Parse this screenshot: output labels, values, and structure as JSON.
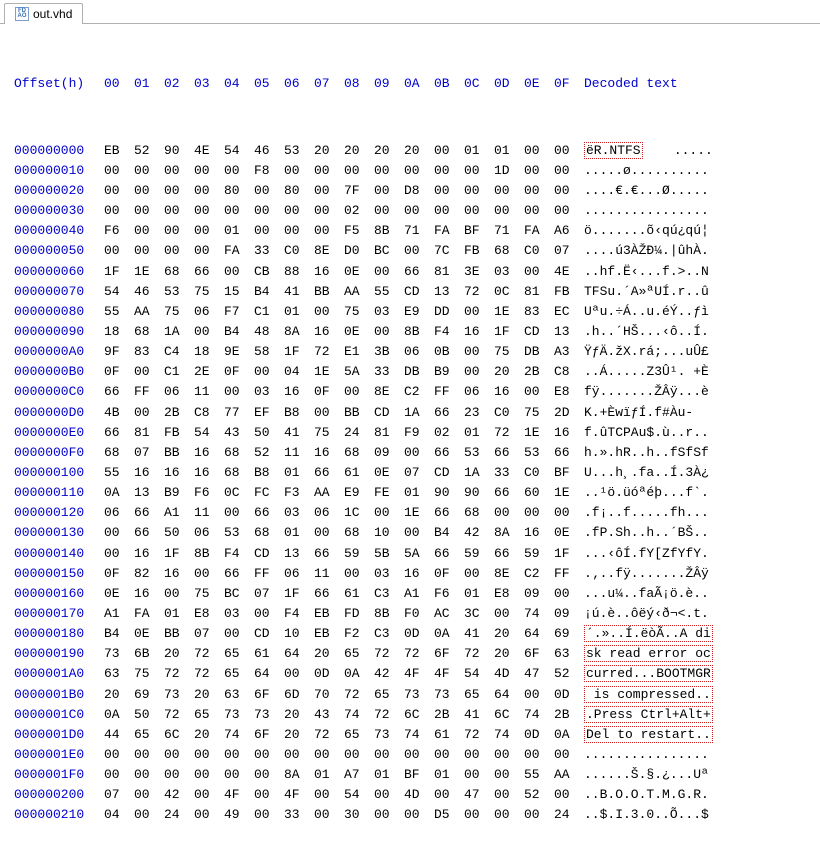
{
  "tab": {
    "filename": "out.vhd",
    "icon_label": "FD\nAO"
  },
  "header": {
    "offset_label": "Offset(h)",
    "byte_cols": [
      "00",
      "01",
      "02",
      "03",
      "04",
      "05",
      "06",
      "07",
      "08",
      "09",
      "0A",
      "0B",
      "0C",
      "0D",
      "0E",
      "0F"
    ],
    "decoded_label": "Decoded text"
  },
  "highlight_row0_decoded_prefix": "ëR.NTFS",
  "highlight_row0_decoded_suffix": "    .....",
  "rows": [
    {
      "o": "000000000",
      "b": [
        "EB",
        "52",
        "90",
        "4E",
        "54",
        "46",
        "53",
        "20",
        "20",
        "20",
        "20",
        "00",
        "01",
        "01",
        "00",
        "00"
      ],
      "d": "ëR.NTFS    ....."
    },
    {
      "o": "000000010",
      "b": [
        "00",
        "00",
        "00",
        "00",
        "00",
        "F8",
        "00",
        "00",
        "00",
        "00",
        "00",
        "00",
        "00",
        "1D",
        "00",
        "00"
      ],
      "d": ".....ø.........."
    },
    {
      "o": "000000020",
      "b": [
        "00",
        "00",
        "00",
        "00",
        "80",
        "00",
        "80",
        "00",
        "7F",
        "00",
        "D8",
        "00",
        "00",
        "00",
        "00",
        "00"
      ],
      "d": "....€.€...Ø....."
    },
    {
      "o": "000000030",
      "b": [
        "00",
        "00",
        "00",
        "00",
        "00",
        "00",
        "00",
        "00",
        "02",
        "00",
        "00",
        "00",
        "00",
        "00",
        "00",
        "00"
      ],
      "d": "................"
    },
    {
      "o": "000000040",
      "b": [
        "F6",
        "00",
        "00",
        "00",
        "01",
        "00",
        "00",
        "00",
        "F5",
        "8B",
        "71",
        "FA",
        "BF",
        "71",
        "FA",
        "A6"
      ],
      "d": "ö.......õ‹qú¿qú¦"
    },
    {
      "o": "000000050",
      "b": [
        "00",
        "00",
        "00",
        "00",
        "FA",
        "33",
        "C0",
        "8E",
        "D0",
        "BC",
        "00",
        "7C",
        "FB",
        "68",
        "C0",
        "07"
      ],
      "d": "....ú3ÀŽÐ¼.|ûhÀ."
    },
    {
      "o": "000000060",
      "b": [
        "1F",
        "1E",
        "68",
        "66",
        "00",
        "CB",
        "88",
        "16",
        "0E",
        "00",
        "66",
        "81",
        "3E",
        "03",
        "00",
        "4E"
      ],
      "d": "..hf.Ë‹...f.>..N"
    },
    {
      "o": "000000070",
      "b": [
        "54",
        "46",
        "53",
        "75",
        "15",
        "B4",
        "41",
        "BB",
        "AA",
        "55",
        "CD",
        "13",
        "72",
        "0C",
        "81",
        "FB"
      ],
      "d": "TFSu.´A»ªUÍ.r..û"
    },
    {
      "o": "000000080",
      "b": [
        "55",
        "AA",
        "75",
        "06",
        "F7",
        "C1",
        "01",
        "00",
        "75",
        "03",
        "E9",
        "DD",
        "00",
        "1E",
        "83",
        "EC"
      ],
      "d": "Uªu.÷Á..u.éÝ..ƒì"
    },
    {
      "o": "000000090",
      "b": [
        "18",
        "68",
        "1A",
        "00",
        "B4",
        "48",
        "8A",
        "16",
        "0E",
        "00",
        "8B",
        "F4",
        "16",
        "1F",
        "CD",
        "13"
      ],
      "d": ".h..´HŠ...‹ô..Í."
    },
    {
      "o": "0000000A0",
      "b": [
        "9F",
        "83",
        "C4",
        "18",
        "9E",
        "58",
        "1F",
        "72",
        "E1",
        "3B",
        "06",
        "0B",
        "00",
        "75",
        "DB",
        "A3"
      ],
      "d": "ŸƒÄ.žX.rá;...uÛ£"
    },
    {
      "o": "0000000B0",
      "b": [
        "0F",
        "00",
        "C1",
        "2E",
        "0F",
        "00",
        "04",
        "1E",
        "5A",
        "33",
        "DB",
        "B9",
        "00",
        "20",
        "2B",
        "C8"
      ],
      "d": "..Á.....Z3Û¹. +È"
    },
    {
      "o": "0000000C0",
      "b": [
        "66",
        "FF",
        "06",
        "11",
        "00",
        "03",
        "16",
        "0F",
        "00",
        "8E",
        "C2",
        "FF",
        "06",
        "16",
        "00",
        "E8"
      ],
      "d": "fÿ.......ŽÂÿ...è"
    },
    {
      "o": "0000000D0",
      "b": [
        "4B",
        "00",
        "2B",
        "C8",
        "77",
        "EF",
        "B8",
        "00",
        "BB",
        "CD",
        "1A",
        "66",
        "23",
        "C0",
        "75",
        "2D"
      ],
      "d": "K.+ÈwïƒÍ.f#Àu-"
    },
    {
      "o": "0000000E0",
      "b": [
        "66",
        "81",
        "FB",
        "54",
        "43",
        "50",
        "41",
        "75",
        "24",
        "81",
        "F9",
        "02",
        "01",
        "72",
        "1E",
        "16"
      ],
      "d": "f.ûTCPAu$.ù..r.."
    },
    {
      "o": "0000000F0",
      "b": [
        "68",
        "07",
        "BB",
        "16",
        "68",
        "52",
        "11",
        "16",
        "68",
        "09",
        "00",
        "66",
        "53",
        "66",
        "53",
        "66"
      ],
      "d": "h.».hR..h..fSfSf"
    },
    {
      "o": "000000100",
      "b": [
        "55",
        "16",
        "16",
        "16",
        "68",
        "B8",
        "01",
        "66",
        "61",
        "0E",
        "07",
        "CD",
        "1A",
        "33",
        "C0",
        "BF"
      ],
      "d": "U...h¸.fa..Í.3À¿"
    },
    {
      "o": "000000110",
      "b": [
        "0A",
        "13",
        "B9",
        "F6",
        "0C",
        "FC",
        "F3",
        "AA",
        "E9",
        "FE",
        "01",
        "90",
        "90",
        "66",
        "60",
        "1E"
      ],
      "d": "..¹ö.üóªéþ...f`."
    },
    {
      "o": "000000120",
      "b": [
        "06",
        "66",
        "A1",
        "11",
        "00",
        "66",
        "03",
        "06",
        "1C",
        "00",
        "1E",
        "66",
        "68",
        "00",
        "00",
        "00"
      ],
      "d": ".f¡..f.....fh..."
    },
    {
      "o": "000000130",
      "b": [
        "00",
        "66",
        "50",
        "06",
        "53",
        "68",
        "01",
        "00",
        "68",
        "10",
        "00",
        "B4",
        "42",
        "8A",
        "16",
        "0E"
      ],
      "d": ".fP.Sh..h..´BŠ.."
    },
    {
      "o": "000000140",
      "b": [
        "00",
        "16",
        "1F",
        "8B",
        "F4",
        "CD",
        "13",
        "66",
        "59",
        "5B",
        "5A",
        "66",
        "59",
        "66",
        "59",
        "1F"
      ],
      "d": "...‹ôÍ.fY[ZfYfY."
    },
    {
      "o": "000000150",
      "b": [
        "0F",
        "82",
        "16",
        "00",
        "66",
        "FF",
        "06",
        "11",
        "00",
        "03",
        "16",
        "0F",
        "00",
        "8E",
        "C2",
        "FF"
      ],
      "d": ".‚..fÿ.......ŽÂÿ"
    },
    {
      "o": "000000160",
      "b": [
        "0E",
        "16",
        "00",
        "75",
        "BC",
        "07",
        "1F",
        "66",
        "61",
        "C3",
        "A1",
        "F6",
        "01",
        "E8",
        "09",
        "00"
      ],
      "d": "...u¼..faÃ¡ö.è.."
    },
    {
      "o": "000000170",
      "b": [
        "A1",
        "FA",
        "01",
        "E8",
        "03",
        "00",
        "F4",
        "EB",
        "FD",
        "8B",
        "F0",
        "AC",
        "3C",
        "00",
        "74",
        "09"
      ],
      "d": "¡ú.è..ôëý‹ð¬<.t."
    },
    {
      "o": "000000180",
      "b": [
        "B4",
        "0E",
        "BB",
        "07",
        "00",
        "CD",
        "10",
        "EB",
        "F2",
        "C3",
        "0D",
        "0A",
        "41",
        "20",
        "64",
        "69"
      ],
      "d": "´.»..Í.ëòÃ..A di"
    },
    {
      "o": "000000190",
      "b": [
        "73",
        "6B",
        "20",
        "72",
        "65",
        "61",
        "64",
        "20",
        "65",
        "72",
        "72",
        "6F",
        "72",
        "20",
        "6F",
        "63"
      ],
      "d": "sk read error oc"
    },
    {
      "o": "0000001A0",
      "b": [
        "63",
        "75",
        "72",
        "72",
        "65",
        "64",
        "00",
        "0D",
        "0A",
        "42",
        "4F",
        "4F",
        "54",
        "4D",
        "47",
        "52"
      ],
      "d": "curred...BOOTMGR"
    },
    {
      "o": "0000001B0",
      "b": [
        "20",
        "69",
        "73",
        "20",
        "63",
        "6F",
        "6D",
        "70",
        "72",
        "65",
        "73",
        "73",
        "65",
        "64",
        "00",
        "0D"
      ],
      "d": " is compressed.."
    },
    {
      "o": "0000001C0",
      "b": [
        "0A",
        "50",
        "72",
        "65",
        "73",
        "73",
        "20",
        "43",
        "74",
        "72",
        "6C",
        "2B",
        "41",
        "6C",
        "74",
        "2B"
      ],
      "d": ".Press Ctrl+Alt+"
    },
    {
      "o": "0000001D0",
      "b": [
        "44",
        "65",
        "6C",
        "20",
        "74",
        "6F",
        "20",
        "72",
        "65",
        "73",
        "74",
        "61",
        "72",
        "74",
        "0D",
        "0A"
      ],
      "d": "Del to restart.."
    },
    {
      "o": "0000001E0",
      "b": [
        "00",
        "00",
        "00",
        "00",
        "00",
        "00",
        "00",
        "00",
        "00",
        "00",
        "00",
        "00",
        "00",
        "00",
        "00",
        "00"
      ],
      "d": "................"
    },
    {
      "o": "0000001F0",
      "b": [
        "00",
        "00",
        "00",
        "00",
        "00",
        "00",
        "8A",
        "01",
        "A7",
        "01",
        "BF",
        "01",
        "00",
        "00",
        "55",
        "AA"
      ],
      "d": "......Š.§.¿...Uª"
    },
    {
      "o": "000000200",
      "b": [
        "07",
        "00",
        "42",
        "00",
        "4F",
        "00",
        "4F",
        "00",
        "54",
        "00",
        "4D",
        "00",
        "47",
        "00",
        "52",
        "00"
      ],
      "d": "..B.O.O.T.M.G.R."
    },
    {
      "o": "000000210",
      "b": [
        "04",
        "00",
        "24",
        "00",
        "49",
        "00",
        "33",
        "00",
        "30",
        "00",
        "00",
        "D5",
        "00",
        "00",
        "00",
        "24"
      ],
      "d": "..$.I.3.0..Õ...$"
    }
  ],
  "highlight_block_range": {
    "start": 24,
    "end": 29
  }
}
